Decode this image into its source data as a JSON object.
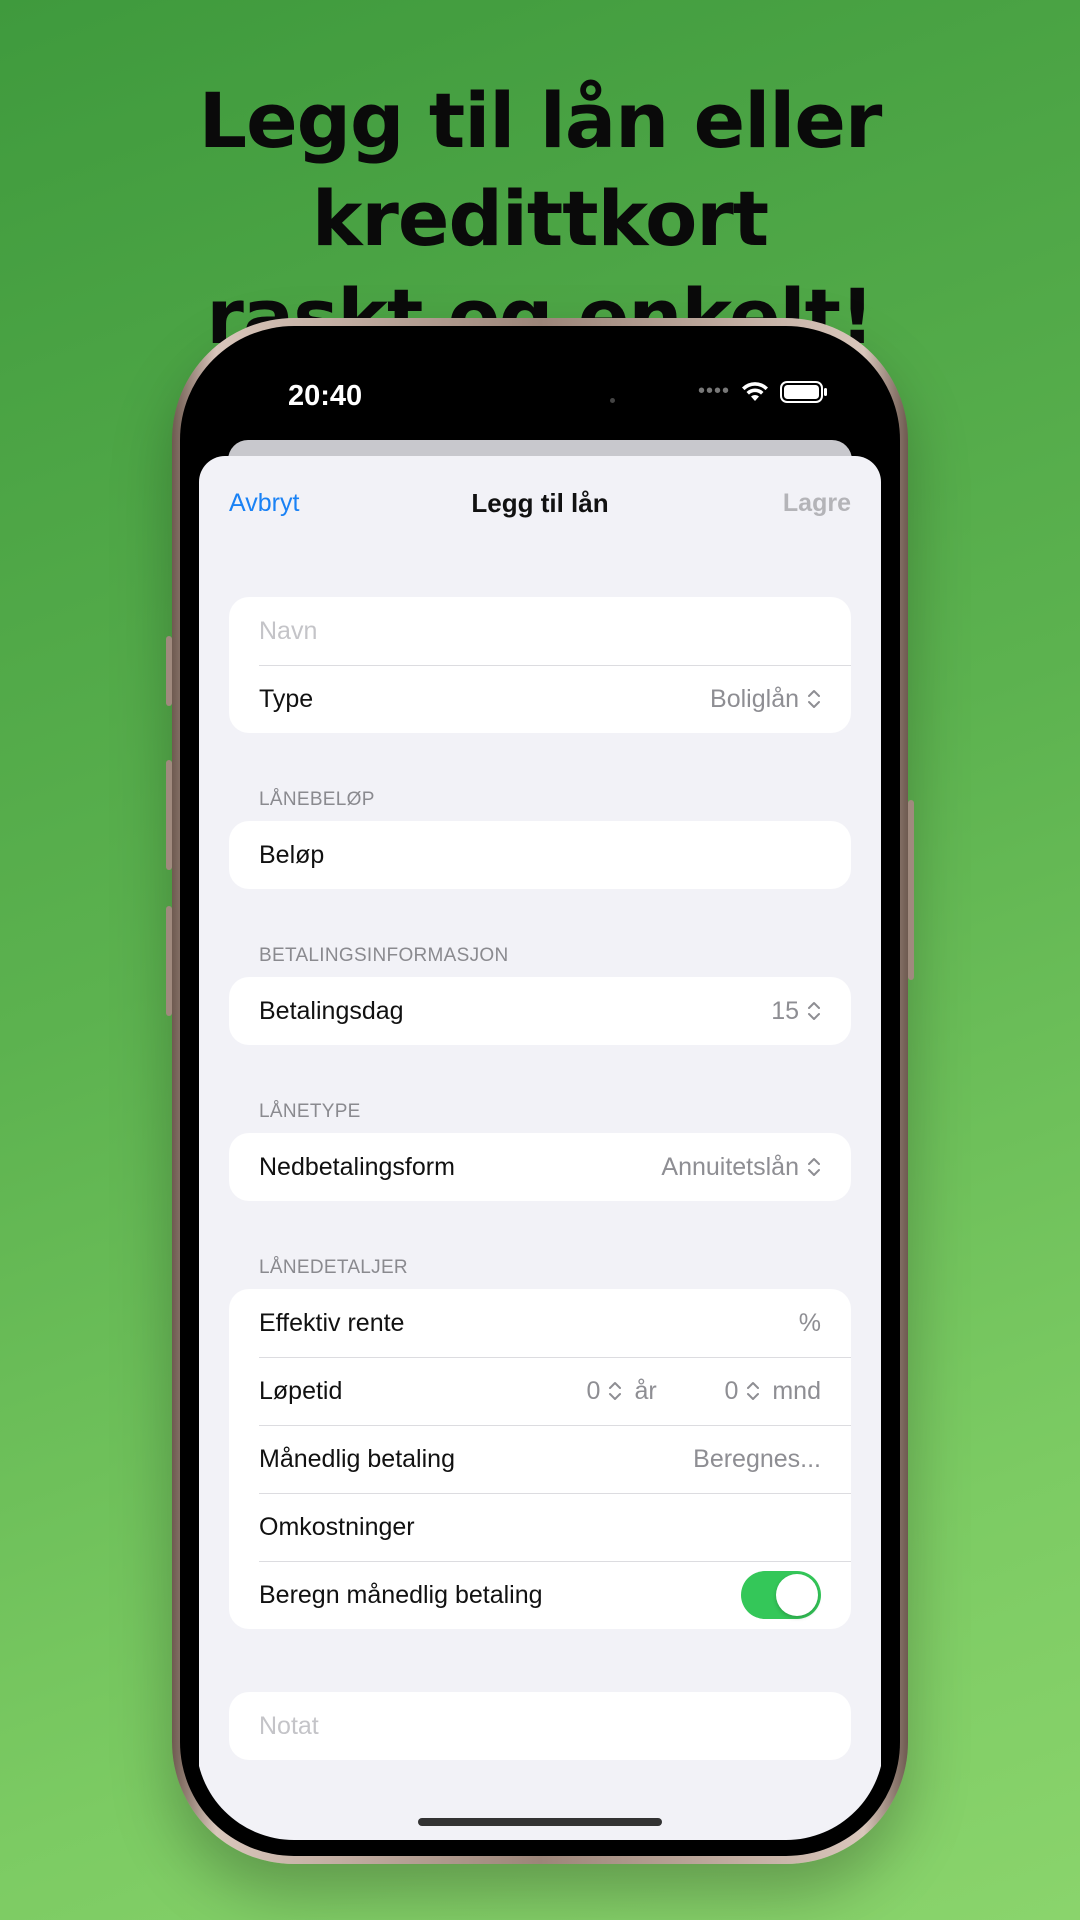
{
  "headline": {
    "line1": "Legg til lån eller kredittkort",
    "line2": "raskt og enkelt!"
  },
  "status_bar": {
    "time": "20:40",
    "icons": [
      "cellular-icon",
      "wifi-icon",
      "battery-icon"
    ]
  },
  "nav": {
    "cancel_label": "Avbryt",
    "title": "Legg til lån",
    "save_label": "Lagre"
  },
  "general": {
    "name_placeholder": "Navn",
    "type_label": "Type",
    "type_value": "Boliglån"
  },
  "loan_amount": {
    "section_label": "LÅNEBELØP",
    "amount_label": "Beløp"
  },
  "payment_info": {
    "section_label": "BETALINGSINFORMASJON",
    "payment_day_label": "Betalingsdag",
    "payment_day_value": "15"
  },
  "loan_type": {
    "section_label": "LÅNETYPE",
    "repayment_label": "Nedbetalingsform",
    "repayment_value": "Annuitetslån"
  },
  "loan_details": {
    "section_label": "LÅNEDETALJER",
    "rate_label": "Effektiv rente",
    "rate_unit": "%",
    "term_label": "Løpetid",
    "term_years_value": "0",
    "term_years_unit": "år",
    "term_months_value": "0",
    "term_months_unit": "mnd",
    "monthly_label": "Månedlig betaling",
    "monthly_value": "Beregnes...",
    "costs_label": "Omkostninger",
    "calc_label": "Beregn månedlig betaling",
    "calc_enabled": true
  },
  "note": {
    "placeholder": "Notat"
  },
  "colors": {
    "accent": "#1a82f5",
    "toggle_on": "#34c759",
    "background_top": "#3f9a3d",
    "background_bottom": "#8ad46c"
  }
}
